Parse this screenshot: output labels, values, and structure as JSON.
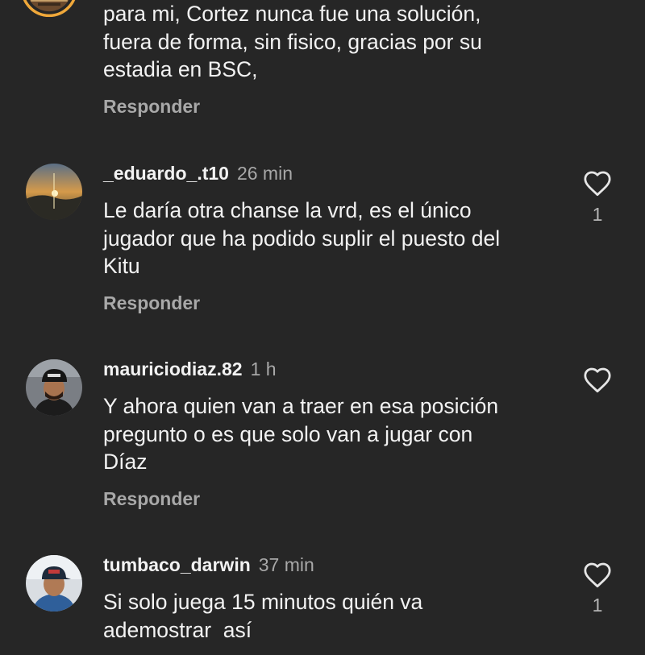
{
  "comments": [
    {
      "username": "",
      "time": "",
      "lines": [
        "para mi, Cortez nunca fue una solución,",
        "fuera de forma, sin fisico, gracias por su",
        "estadia en BSC,"
      ],
      "reply_label": "Responder",
      "likes": ""
    },
    {
      "username": "_eduardo_.t10",
      "time": "26 min",
      "lines": [
        "Le daría otra chanse la vrd, es el único",
        "jugador que ha podido suplir el puesto del",
        "Kitu"
      ],
      "reply_label": "Responder",
      "likes": "1"
    },
    {
      "username": "mauriciodiaz.82",
      "time": "1 h",
      "lines": [
        "Y ahora quien van a traer en esa posición",
        "pregunto o es que solo van a jugar con",
        "Díaz"
      ],
      "reply_label": "Responder",
      "likes": ""
    },
    {
      "username": "tumbaco_darwin",
      "time": "37 min",
      "lines": [
        "Si solo juega 15 minutos quién va",
        "ademostrar  así"
      ],
      "reply_label": "",
      "likes": "1"
    }
  ],
  "icons": {
    "like": "heart-outline-icon"
  },
  "colors": {
    "background": "#262626",
    "text": "#f2f2f2",
    "secondary_text": "#a8a8a8",
    "story_ring": "#f0a83a"
  }
}
